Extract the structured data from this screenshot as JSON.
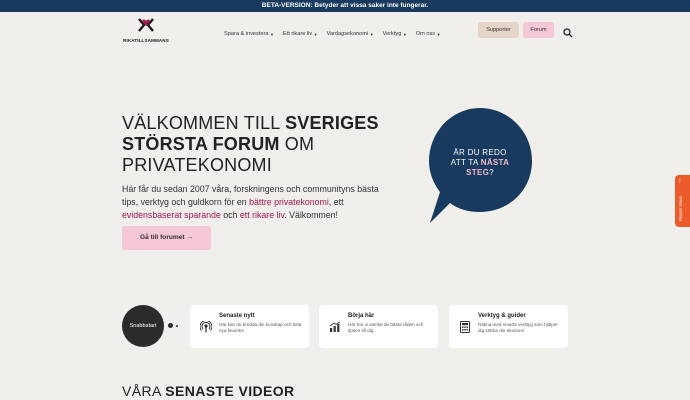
{
  "beta_banner": "BETA-VERSION: Betyder att vissa saker inte fungerar.",
  "logo": {
    "text": "RIKATILLSAMMANS"
  },
  "nav": [
    {
      "label": "Spara & investera"
    },
    {
      "label": "Ett rikare liv"
    },
    {
      "label": "Vardagsekonomi"
    },
    {
      "label": "Verktyg"
    },
    {
      "label": "Om oss"
    }
  ],
  "header_buttons": {
    "supporter": "Supporter",
    "forum": "Forum"
  },
  "hero": {
    "title_line1_normal": "VÄLKOMMEN TILL ",
    "title_line1_bold": "SVERIGES",
    "title_line2_bold": "STÖRSTA FORUM",
    "title_line2_normal": " OM",
    "title_line3": "PRIVATEKONOMI",
    "text_part1": "Här får du sedan 2007 våra, forskningens och communityns bästa tips, verktyg och guldkorn för en ",
    "text_hl1": "bättre privatekonomi",
    "text_part2": ", ett ",
    "text_hl2": "evidensbaserat sparande",
    "text_part3": " och ",
    "text_hl3": "ett rikare liv",
    "text_part4": ". Välkommen!",
    "cta": "Gå till forumet →"
  },
  "bubble": {
    "line1": "ÄR DU REDO",
    "line2": "ATT TA ",
    "line2_bold": "NÄSTA",
    "line3_bold": "STEG",
    "line3_rest": "?"
  },
  "report_issue": "Report Issue",
  "quickstart": {
    "label": "Snabbstart",
    "cards": [
      {
        "title": "Senaste nytt",
        "desc": "Här kan du bredda din kunskap och hitta nya favoriter",
        "icon": "podcast-icon"
      },
      {
        "title": "Börja här",
        "desc": "Här har vi samlat de bästa råden och tipsen till dig",
        "icon": "chart-bar-icon"
      },
      {
        "title": "Verktyg & guider",
        "desc": "Räkna med smarta verktyg som hjälper dig stärka din ekonomi",
        "icon": "calculator-icon"
      }
    ]
  },
  "videos": {
    "normal": "VÅRA ",
    "bold": "SENASTE VIDEOR"
  },
  "colors": {
    "navy": "#173a5e",
    "pink": "#f6c7d4",
    "accent": "#a3174e",
    "report": "#ec5b2a"
  }
}
